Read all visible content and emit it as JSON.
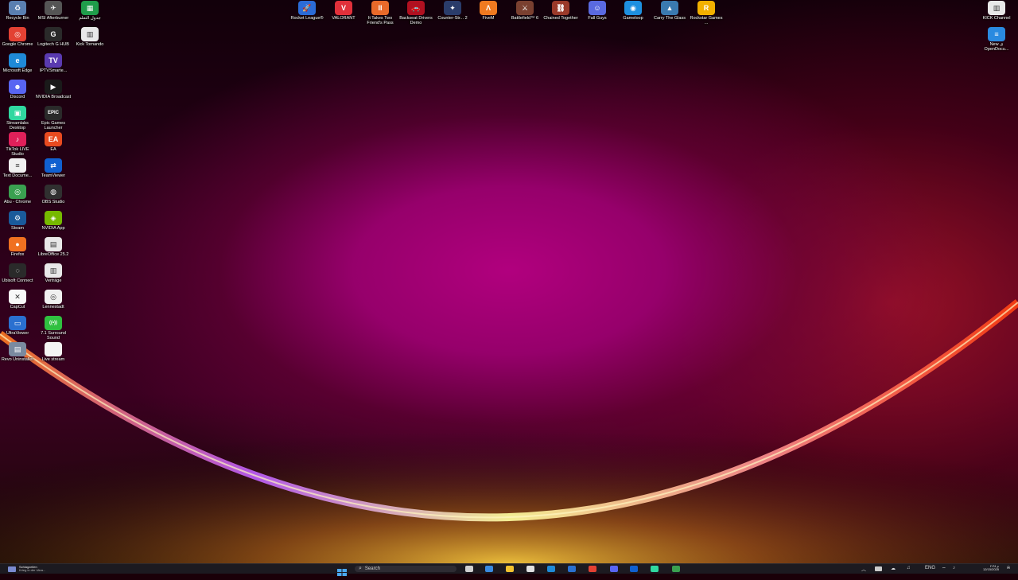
{
  "desktop_icons": [
    {
      "label": "Recycle Bin",
      "name": "recycle-bin-icon",
      "bg": "#5a7fb0",
      "glyph": "♻"
    },
    {
      "label": "MSI Afterburner",
      "name": "msi-afterburner-icon",
      "bg": "#555555",
      "glyph": "✈"
    },
    {
      "label": "جدول التعلم",
      "name": "spreadsheet-icon",
      "bg": "#1f9d4a",
      "glyph": "▦"
    },
    {
      "label": "Rocket League®",
      "name": "rocket-league-icon",
      "bg": "#2b6bd6",
      "glyph": "🚀"
    },
    {
      "label": "VALORANT",
      "name": "valorant-icon",
      "bg": "#e0303a",
      "glyph": "V"
    },
    {
      "label": "It Takes Two Friend's Pass",
      "name": "it-takes-two-icon",
      "bg": "#e86a2a",
      "glyph": "II"
    },
    {
      "label": "Backseat Drivers Demo",
      "name": "backseat-drivers-icon",
      "bg": "#b01020",
      "glyph": "🚗"
    },
    {
      "label": "Counter-Str... 2",
      "name": "counter-strike-icon",
      "bg": "#2a3c6a",
      "glyph": "✦"
    },
    {
      "label": "FiveM",
      "name": "fivem-icon",
      "bg": "#f07a20",
      "glyph": "Λ"
    },
    {
      "label": "Battlefield™ 6",
      "name": "battlefield-icon",
      "bg": "#7a4030",
      "glyph": "⚔"
    },
    {
      "label": "Chained Together",
      "name": "chained-together-icon",
      "bg": "#9a3a2a",
      "glyph": "⛓"
    },
    {
      "label": "Fall Guys",
      "name": "fall-guys-icon",
      "bg": "#5a6ae0",
      "glyph": "☺"
    },
    {
      "label": "Gameloop",
      "name": "gameloop-icon",
      "bg": "#1e90e0",
      "glyph": "◉"
    },
    {
      "label": "Carry The Glass",
      "name": "carry-the-glass-icon",
      "bg": "#3a7ab0",
      "glyph": "▲"
    },
    {
      "label": "Rockstar Games ...",
      "name": "rockstar-games-icon",
      "bg": "#f2b000",
      "glyph": "R"
    },
    {
      "label": "KICK Channel",
      "name": "kick-channel-icon",
      "bg": "#e8e8e8",
      "glyph": "▥"
    },
    {
      "label": "New ی OpenDocu...",
      "name": "opendocument-icon",
      "bg": "#2a8ae0",
      "glyph": "≡"
    },
    {
      "label": "Google Chrome",
      "name": "google-chrome-icon",
      "bg": "#e34133",
      "glyph": "◎"
    },
    {
      "label": "Logitech G HUB",
      "name": "logitech-ghub-icon",
      "bg": "#2a2a2a",
      "glyph": "G"
    },
    {
      "label": "Kick Tornando",
      "name": "kick-tornando-icon",
      "bg": "#e8e8e8",
      "glyph": "▥"
    },
    {
      "label": "Microsoft Edge",
      "name": "microsoft-edge-icon",
      "bg": "#1f8ad8",
      "glyph": "e"
    },
    {
      "label": "IPTVSmarte...",
      "name": "iptv-smarters-icon",
      "bg": "#5a3ab0",
      "glyph": "TV"
    },
    {
      "label": "Discord",
      "name": "discord-icon",
      "bg": "#5865f2",
      "glyph": "☻"
    },
    {
      "label": "NVIDIA Broadcast",
      "name": "nvidia-broadcast-icon",
      "bg": "#1a1a1a",
      "glyph": "▶"
    },
    {
      "label": "Streamlabs Desktop",
      "name": "streamlabs-icon",
      "bg": "#30d8a0",
      "glyph": "▣"
    },
    {
      "label": "Epic Games Launcher",
      "name": "epic-games-icon",
      "bg": "#2a2a2a",
      "glyph": "EPIC"
    },
    {
      "label": "TikTok LIVE Studio",
      "name": "tiktok-live-icon",
      "bg": "#e0205a",
      "glyph": "♪"
    },
    {
      "label": "EA",
      "name": "ea-icon",
      "bg": "#e84a20",
      "glyph": "EA"
    },
    {
      "label": "Text Docume...",
      "name": "text-document-icon",
      "bg": "#f0f0f0",
      "glyph": "≡"
    },
    {
      "label": "TeamViewer",
      "name": "teamviewer-icon",
      "bg": "#1060d0",
      "glyph": "⇄"
    },
    {
      "label": "Abu - Chrome",
      "name": "abu-chrome-icon",
      "bg": "#3aa050",
      "glyph": "◎"
    },
    {
      "label": "OBS Studio",
      "name": "obs-studio-icon",
      "bg": "#303030",
      "glyph": "◍"
    },
    {
      "label": "Steam",
      "name": "steam-icon",
      "bg": "#1a5a9a",
      "glyph": "⚙"
    },
    {
      "label": "NVIDIA App",
      "name": "nvidia-app-icon",
      "bg": "#76b900",
      "glyph": "◈"
    },
    {
      "label": "Firefox",
      "name": "firefox-icon",
      "bg": "#f07020",
      "glyph": "●"
    },
    {
      "label": "LibreOffice 25.2",
      "name": "libreoffice-icon",
      "bg": "#e8e8e8",
      "glyph": "▤"
    },
    {
      "label": "Ubisoft Connect",
      "name": "ubisoft-connect-icon",
      "bg": "#2a2a2a",
      "glyph": "◌"
    },
    {
      "label": "Verträge",
      "name": "vertraege-icon",
      "bg": "#e8e8e8",
      "glyph": "▥"
    },
    {
      "label": "CapCut",
      "name": "capcut-icon",
      "bg": "#f8f8f8",
      "glyph": "✕"
    },
    {
      "label": "Lennestadt",
      "name": "lennestadt-icon",
      "bg": "#f0f0f0",
      "glyph": "◎"
    },
    {
      "label": "UltraViewer",
      "name": "ultraviewer-icon",
      "bg": "#2a70d0",
      "glyph": "▭"
    },
    {
      "label": "7.1 Surround Sound",
      "name": "surround-sound-icon",
      "bg": "#30c040",
      "glyph": "((•))"
    },
    {
      "label": "Revo Uninstaller",
      "name": "revo-uninstaller-icon",
      "bg": "#7a8aa0",
      "glyph": "▤"
    },
    {
      "label": "Live stream",
      "name": "live-stream-icon",
      "bg": "#f4f4f4",
      "glyph": " "
    }
  ],
  "taskbar": {
    "news_title": "Schlagzeilen",
    "news_sub": "Krieg in der Ukra...",
    "search_placeholder": "Search",
    "tray_time": "۲:۳۸ م",
    "tray_date": "12/15/2025",
    "tray_lang": "ENG",
    "pinned": [
      {
        "name": "task-view-icon",
        "color": "#d0d0d0"
      },
      {
        "name": "widgets-icon",
        "color": "#3a8ae0"
      },
      {
        "name": "file-explorer-icon",
        "color": "#f2c230"
      },
      {
        "name": "microsoft-store-icon",
        "color": "#e0e0e0"
      },
      {
        "name": "edge-taskbar-icon",
        "color": "#1f8ad8"
      },
      {
        "name": "mail-taskbar-icon",
        "color": "#2a70d0"
      },
      {
        "name": "chrome-taskbar-icon",
        "color": "#e34133"
      },
      {
        "name": "discord-taskbar-icon",
        "color": "#5865f2"
      },
      {
        "name": "teamviewer-taskbar-icon",
        "color": "#1060d0"
      },
      {
        "name": "streamlabs-taskbar-icon",
        "color": "#30d8a0"
      },
      {
        "name": "chrome-profile-taskbar-icon",
        "color": "#3aa050"
      }
    ]
  }
}
